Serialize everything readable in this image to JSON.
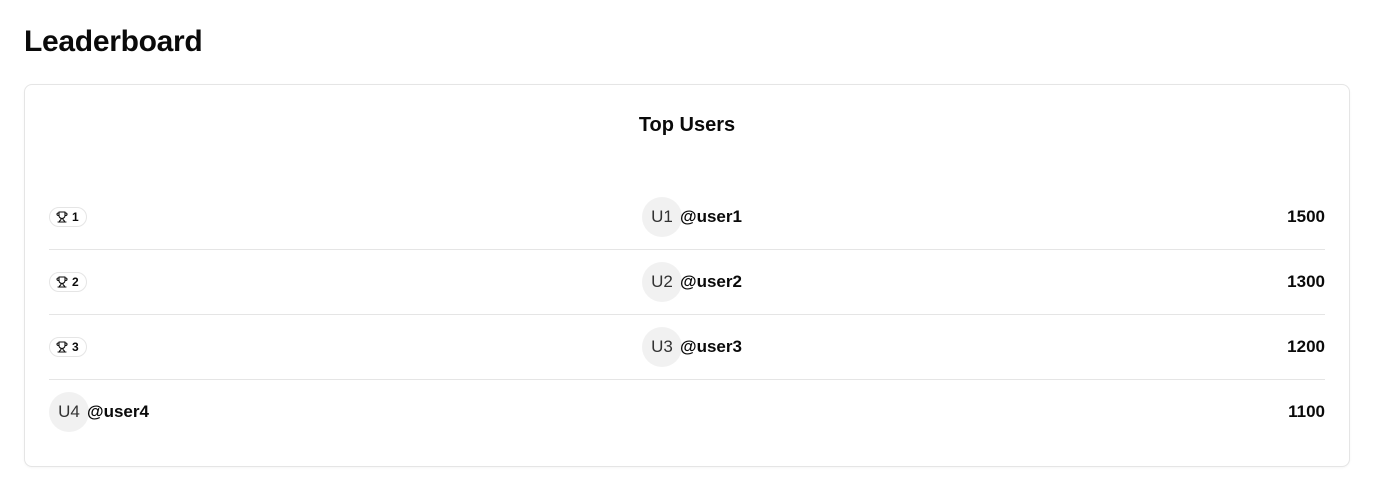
{
  "page": {
    "title": "Leaderboard"
  },
  "card": {
    "title": "Top Users"
  },
  "entries": [
    {
      "rank": "1",
      "avatar": "U1",
      "handle": "@user1",
      "score": "1500",
      "icon": "trophy-icon"
    },
    {
      "rank": "2",
      "avatar": "U2",
      "handle": "@user2",
      "score": "1300",
      "icon": "trophy-icon"
    },
    {
      "rank": "3",
      "avatar": "U3",
      "handle": "@user3",
      "score": "1200",
      "icon": "trophy-icon"
    },
    {
      "avatar": "U4",
      "handle": "@user4",
      "score": "1100"
    }
  ],
  "colors": {
    "border": "#e5e5e5",
    "avatar_bg": "#f1f1f1",
    "text": "#0a0a0a"
  }
}
